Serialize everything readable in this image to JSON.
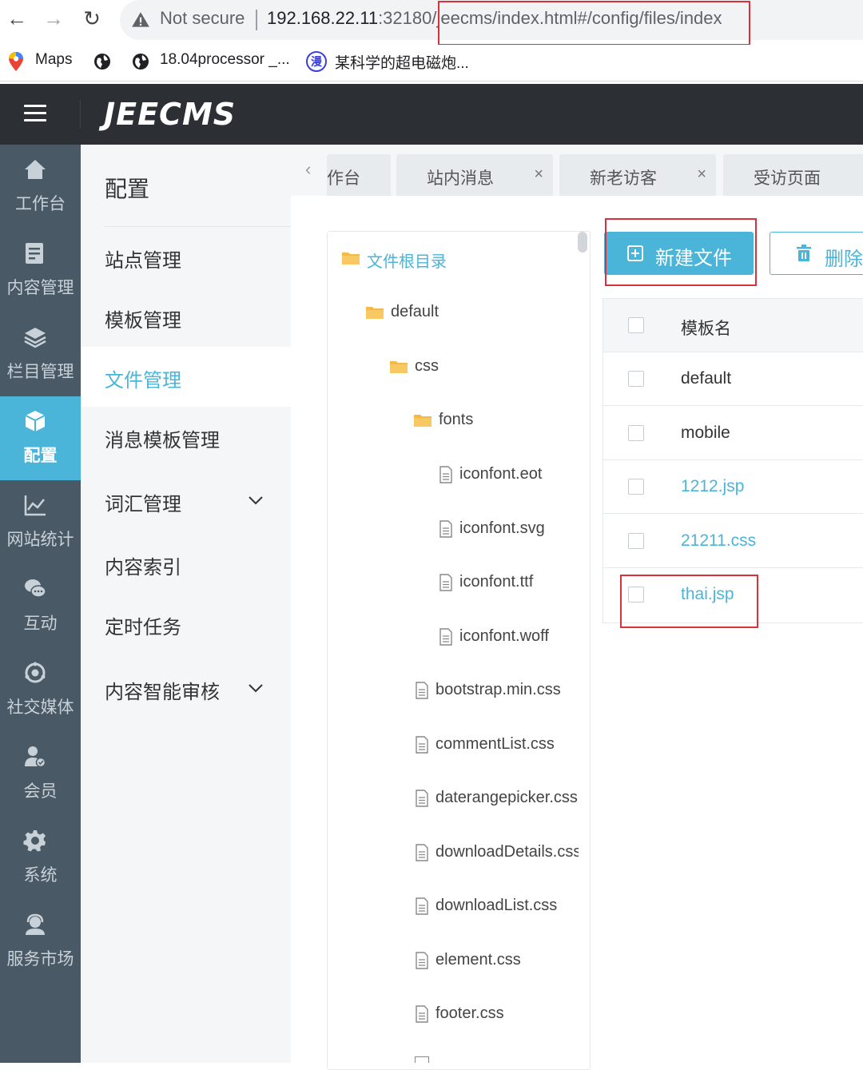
{
  "browser": {
    "security_label": "Not secure",
    "url_host": "192.168.22.11",
    "url_port_prefix": ":32180/",
    "url_path": "jeecms/index.html#/config/files/index",
    "bookmarks": [
      "Maps",
      "18.04processor _...",
      "某科学的超电磁炮..."
    ],
    "bookmark_badge": "漫"
  },
  "app": {
    "logo": "JEECMS",
    "rail": [
      {
        "label": "工作台",
        "icon": "home-icon"
      },
      {
        "label": "内容管理",
        "icon": "document-icon"
      },
      {
        "label": "栏目管理",
        "icon": "layers-icon"
      },
      {
        "label": "配置",
        "icon": "cube-icon",
        "active": true
      },
      {
        "label": "网站统计",
        "icon": "line-chart-icon"
      },
      {
        "label": "互动",
        "icon": "chat-bubbles-icon"
      },
      {
        "label": "社交媒体",
        "icon": "social-ring-icon"
      },
      {
        "label": "会员",
        "icon": "member-icon"
      },
      {
        "label": "系统",
        "icon": "gear-icon"
      },
      {
        "label": "服务市场",
        "icon": "service-headset-icon"
      }
    ],
    "menu": {
      "title": "配置",
      "items": [
        "站点管理",
        "模板管理",
        "文件管理",
        "消息模板管理",
        "词汇管理",
        "内容索引",
        "定时任务",
        "内容智能审核"
      ],
      "active_index": 2
    },
    "tabs": [
      "作台",
      "站内消息",
      "新老访客",
      "受访页面"
    ],
    "tab_close": "×",
    "tree": {
      "root": "文件根目录",
      "nodes": [
        "default",
        "css",
        "fonts",
        "iconfont.eot",
        "iconfont.svg",
        "iconfont.ttf",
        "iconfont.woff",
        "bootstrap.min.css",
        "commentList.css",
        "daterangepicker.css",
        "downloadDetails.css",
        "downloadList.css",
        "element.css",
        "footer.css"
      ]
    },
    "toolbar": {
      "new_label": "新建文件",
      "delete_label": "删除"
    },
    "table": {
      "header": "模板名",
      "rows": [
        "default",
        "mobile",
        "1212.jsp",
        "21211.css",
        "thai.jsp"
      ]
    },
    "colors": {
      "accent": "#4bb5d9",
      "rail_bg": "#4a5966",
      "header_bg": "#2c3034",
      "highlight_box": "#d9303b"
    }
  }
}
